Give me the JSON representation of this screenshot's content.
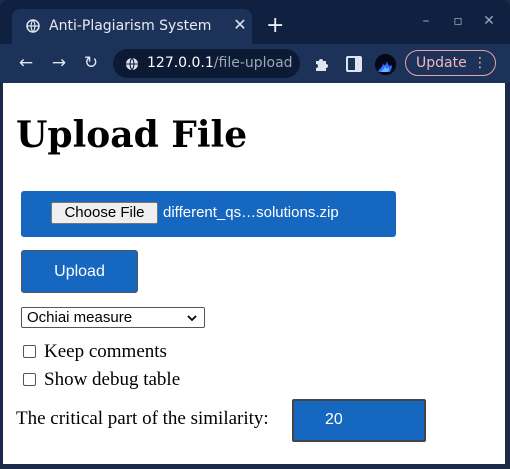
{
  "browser": {
    "tab": {
      "title": "Anti-Plagiarism System",
      "close_icon": "close-icon"
    },
    "new_tab_icon": "plus-icon",
    "window_controls": [
      "minimize-icon",
      "maximize-icon",
      "close-icon"
    ],
    "address": {
      "host": "127.0.0.1",
      "path": "/file-upload"
    },
    "update_label": "Update"
  },
  "page": {
    "title": "Upload File",
    "file_input": {
      "button_label": "Choose File",
      "file_name": "different_qs…solutions.zip"
    },
    "upload_label": "Upload",
    "measure_select": {
      "selected": "Ochiai measure"
    },
    "options": [
      {
        "label": "Keep comments",
        "checked": false
      },
      {
        "label": "Show debug table",
        "checked": false
      }
    ],
    "critical": {
      "label": "The critical part of the similarity:",
      "value": "20"
    }
  },
  "colors": {
    "accent": "#1667c0",
    "tab_bar": "#0f2040",
    "toolbar": "#1c3258"
  }
}
